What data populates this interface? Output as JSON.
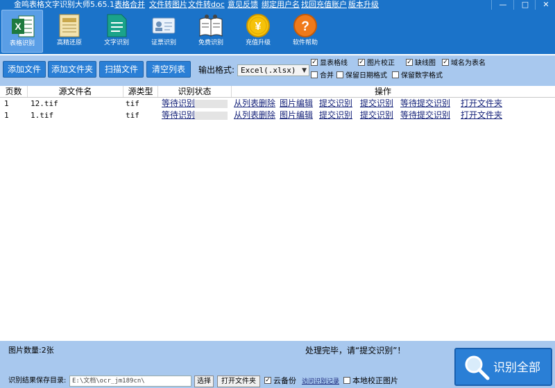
{
  "window": {
    "title": "金鸣表格文字识别大师5.65.1",
    "menu_links": [
      "表格合并",
      "文件转图片",
      "文件转doc",
      "意见反馈",
      "绑定用户名",
      "找回充值账户",
      "版本升级"
    ],
    "controls": {
      "minimize": "—",
      "maximize": "□",
      "close": "✕"
    }
  },
  "toolbar": {
    "items": [
      {
        "label": "表格识别",
        "icon": "excel-icon",
        "active": true
      },
      {
        "label": "高精还原",
        "icon": "document-restore-icon"
      },
      {
        "label": "文字识别",
        "icon": "text-document-icon"
      },
      {
        "label": "证票识别",
        "icon": "id-card-icon"
      },
      {
        "label": "免费识别",
        "icon": "open-book-icon"
      },
      {
        "label": "充值升级",
        "icon": "yen-coin-icon"
      },
      {
        "label": "软件帮助",
        "icon": "help-icon"
      }
    ]
  },
  "actions": {
    "add_file": "添加文件",
    "add_folder": "添加文件夹",
    "scan_file": "扫描文件",
    "clear_list": "清空列表",
    "output_format_label": "输出格式:",
    "output_format_value": "Excel(.xlsx)",
    "options": [
      {
        "label": "显表格线",
        "checked": true
      },
      {
        "label": "图片校正",
        "checked": true
      },
      {
        "label": "缺线图",
        "checked": true
      },
      {
        "label": "域名为表名",
        "checked": true
      },
      {
        "label": "合并",
        "checked": false
      },
      {
        "label": "保留日期格式",
        "checked": false
      },
      {
        "label": "保留数字格式",
        "checked": false
      }
    ]
  },
  "table": {
    "headers": [
      "页数",
      "源文件名",
      "源类型",
      "识别状态",
      "操作"
    ],
    "rows": [
      {
        "page": "1",
        "filename": "12.tif",
        "type": "tif",
        "status": "等待识别",
        "progress": 0,
        "ops": [
          "从列表删除",
          "图片编辑",
          "提交识别",
          "提交识别",
          "等待提交识别",
          "打开文件夹"
        ]
      },
      {
        "page": "1",
        "filename": "1.tif",
        "type": "tif",
        "status": "等待识别",
        "progress": 0,
        "ops": [
          "从列表删除",
          "图片编辑",
          "提交识别",
          "提交识别",
          "等待提交识别",
          "打开文件夹"
        ]
      }
    ]
  },
  "status": {
    "image_count": "图片数量:2张",
    "message": "处理完毕，请“提交识别”！",
    "save_dir_label": "识别结果保存目录:",
    "save_dir_value": "E:\\文档\\ocr_jm189cn\\",
    "select_btn": "选择",
    "open_folder_btn": "打开文件夹",
    "cloud_backup": "云备份",
    "cloud_backup_checked": true,
    "access_records": "访问识别记录",
    "local_correct": "本地校正图片",
    "local_correct_checked": false,
    "recognize_all": "识别全部"
  },
  "colors": {
    "banner": "#1b73c9",
    "band": "#a8c8ee",
    "button": "#2a7fd6",
    "link": "#16237a"
  }
}
